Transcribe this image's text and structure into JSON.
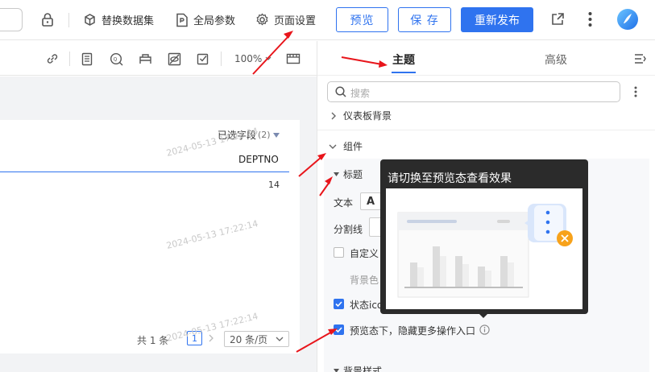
{
  "topbar": {
    "replace_dataset": "替换数据集",
    "global_params": "全局参数",
    "page_settings": "页面设置",
    "preview": "预览",
    "save": "保 存",
    "republish": "重新发布"
  },
  "toolbar2": {
    "zoom": "100%"
  },
  "table": {
    "selected_fields_label": "已选字段",
    "selected_fields_count": "(2)",
    "column_header": "DEPTNO",
    "cell_value": "14",
    "watermark": "2024-05-13 17:22:14",
    "pagination": {
      "total": "共 1 条",
      "current_page": "1",
      "page_size": "20 条/页"
    }
  },
  "panel": {
    "tabs": [
      "主题",
      "高级"
    ],
    "active_tab": "主题",
    "search_placeholder": "搜索",
    "sections": {
      "dashboard_bg": "仪表板背景",
      "component": "组件",
      "title": "标题",
      "text": "文本",
      "divider": "分割线",
      "custom": "自定义",
      "bg_color": "背景色",
      "status_icon": "状态icon",
      "hide_more_actions": "预览态下，隐藏更多操作入口",
      "bg_style": "背景样式"
    }
  },
  "tooltip": {
    "title": "请切换至预览态查看效果"
  },
  "colors": {
    "accent": "#2f73ef",
    "annotation": "#e8151b"
  }
}
